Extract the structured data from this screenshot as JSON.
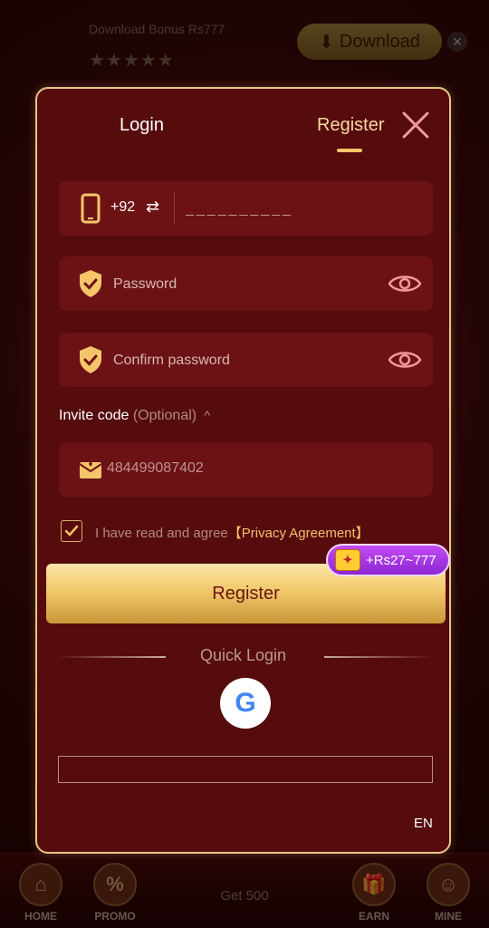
{
  "background": {
    "download_text": "Download Bonus Rs777",
    "stars": "★★★★★",
    "download_button": "Download",
    "nav": {
      "home": "HOME",
      "promo": "PROMO",
      "get": "Get 500",
      "earn": "EARN",
      "mine": "MINE"
    }
  },
  "modal": {
    "tabs": {
      "login": "Login",
      "register": "Register"
    },
    "phone": {
      "country_code": "+92",
      "placeholder": "__________"
    },
    "password": {
      "placeholder": "Password"
    },
    "confirm": {
      "placeholder": "Confirm password"
    },
    "invite": {
      "label": "Invite code",
      "optional": "(Optional)",
      "value": "484499087402"
    },
    "agreement": {
      "text": "I have read and agree",
      "link": "【Privacy Agreement】"
    },
    "register_button": "Register",
    "bonus_badge": "+Rs27~777",
    "quick_login": "Quick Login",
    "google_letter": "G",
    "language": "EN"
  },
  "colors": {
    "modal_bg": "#560b0d",
    "field_bg": "#6c1214",
    "gold_border": "#e6c585",
    "accent_gold": "#f0c26a",
    "badge_purple": "#a43be0"
  }
}
